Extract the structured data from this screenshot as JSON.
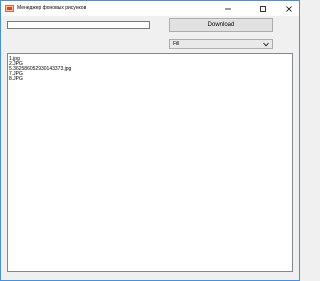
{
  "window": {
    "title": "Менеджер фоновых рисунков",
    "controls": {
      "minimize_icon": "minimize-icon",
      "maximize_icon": "maximize-icon",
      "close_icon": "close-icon"
    }
  },
  "toolbar": {
    "url_value": "",
    "download_label": "Download",
    "mode_selected": "Fill"
  },
  "files": [
    "1.jpg",
    "2.JPG",
    "5.36258605293014337​3.jpg",
    "7.JPG",
    "8.JPG"
  ],
  "colors": {
    "accent_border": "#4a90d9",
    "window_bg": "#f0f0f0",
    "icon_red": "#d9442b"
  }
}
